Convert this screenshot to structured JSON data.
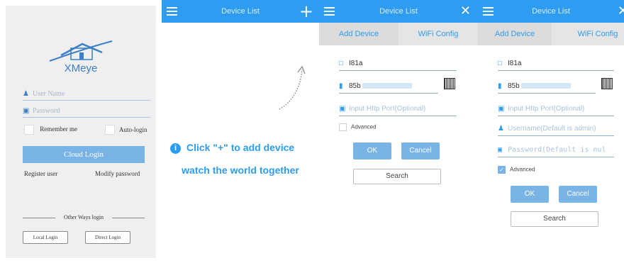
{
  "login": {
    "app_name": "XMeye",
    "username_placeholder": "User Name",
    "password_placeholder": "Password",
    "remember_me": "Remember me",
    "auto_login": "Auto-login",
    "cloud_login": "Cloud Login",
    "register_user": "Register user",
    "modify_password": "Modify password",
    "other_ways": "Other Ways login",
    "local_login": "Local Login",
    "direct_login": "Direct Login"
  },
  "device_list": {
    "title": "Device List",
    "hint_line1": "Click \"+\" to add device",
    "hint_line2": "watch the world together"
  },
  "add_device_a": {
    "title": "Device List",
    "tab_add": "Add Device",
    "tab_wifi": "WiFi Config",
    "device_name": "I81a",
    "serial_prefix": "85b",
    "port_placeholder": "Input Http Port(Optional)",
    "advanced": "Advanced",
    "ok": "OK",
    "cancel": "Cancel",
    "search": "Search"
  },
  "add_device_b": {
    "title": "Device List",
    "tab_add": "Add Device",
    "tab_wifi": "WiFi Config",
    "device_name": "I81a",
    "serial_prefix": "85b",
    "port_placeholder": "Input Http Port(Optional)",
    "username_placeholder": "Username(Default is admin)",
    "password_placeholder": "Password(Default is nul",
    "advanced": "Advanced",
    "ok": "OK",
    "cancel": "Cancel",
    "search": "Search"
  },
  "colors": {
    "accent": "#2e9cf0",
    "button": "#7ab3e6",
    "logo_blue": "#3a7fc8"
  },
  "icons": [
    "house-logo-icon",
    "user-icon",
    "lock-icon",
    "menu-icon",
    "plus-icon",
    "close-icon",
    "info-icon",
    "monitor-icon",
    "barcode-icon",
    "qr-code-icon",
    "port-icon",
    "curved-arrow-icon"
  ]
}
